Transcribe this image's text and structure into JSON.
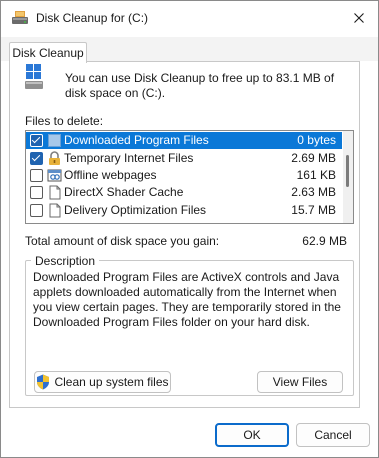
{
  "window": {
    "title": "Disk Cleanup for  (C:)"
  },
  "tabs": [
    {
      "label": "Disk Cleanup"
    }
  ],
  "intro_text": "You can use Disk Cleanup to free up to 83.1 MB of disk space on  (C:).",
  "files_label": "Files to delete:",
  "files": [
    {
      "name": "Downloaded Program Files",
      "size": "0 bytes",
      "checked": true,
      "selected": true,
      "icon": "folder-icon"
    },
    {
      "name": "Temporary Internet Files",
      "size": "2.69 MB",
      "checked": true,
      "selected": false,
      "icon": "lock-icon"
    },
    {
      "name": "Offline webpages",
      "size": "161 KB",
      "checked": false,
      "selected": false,
      "icon": "offline-pages-icon"
    },
    {
      "name": "DirectX Shader Cache",
      "size": "2.63 MB",
      "checked": false,
      "selected": false,
      "icon": "file-icon"
    },
    {
      "name": "Delivery Optimization Files",
      "size": "15.7 MB",
      "checked": false,
      "selected": false,
      "icon": "file-icon"
    }
  ],
  "total": {
    "label": "Total amount of disk space you gain:",
    "value": "62.9 MB"
  },
  "description": {
    "title": "Description",
    "text": "Downloaded Program Files are ActiveX controls and Java applets downloaded automatically from the Internet when you view certain pages. They are temporarily stored in the Downloaded Program Files folder on your hard disk."
  },
  "buttons": {
    "cleanup_system": "Clean up system files",
    "view_files": "View Files",
    "ok": "OK",
    "cancel": "Cancel"
  },
  "colors": {
    "selection": "#0b78d7",
    "checkbox": "#1f63b0",
    "primary_border": "#0b6bcb"
  }
}
